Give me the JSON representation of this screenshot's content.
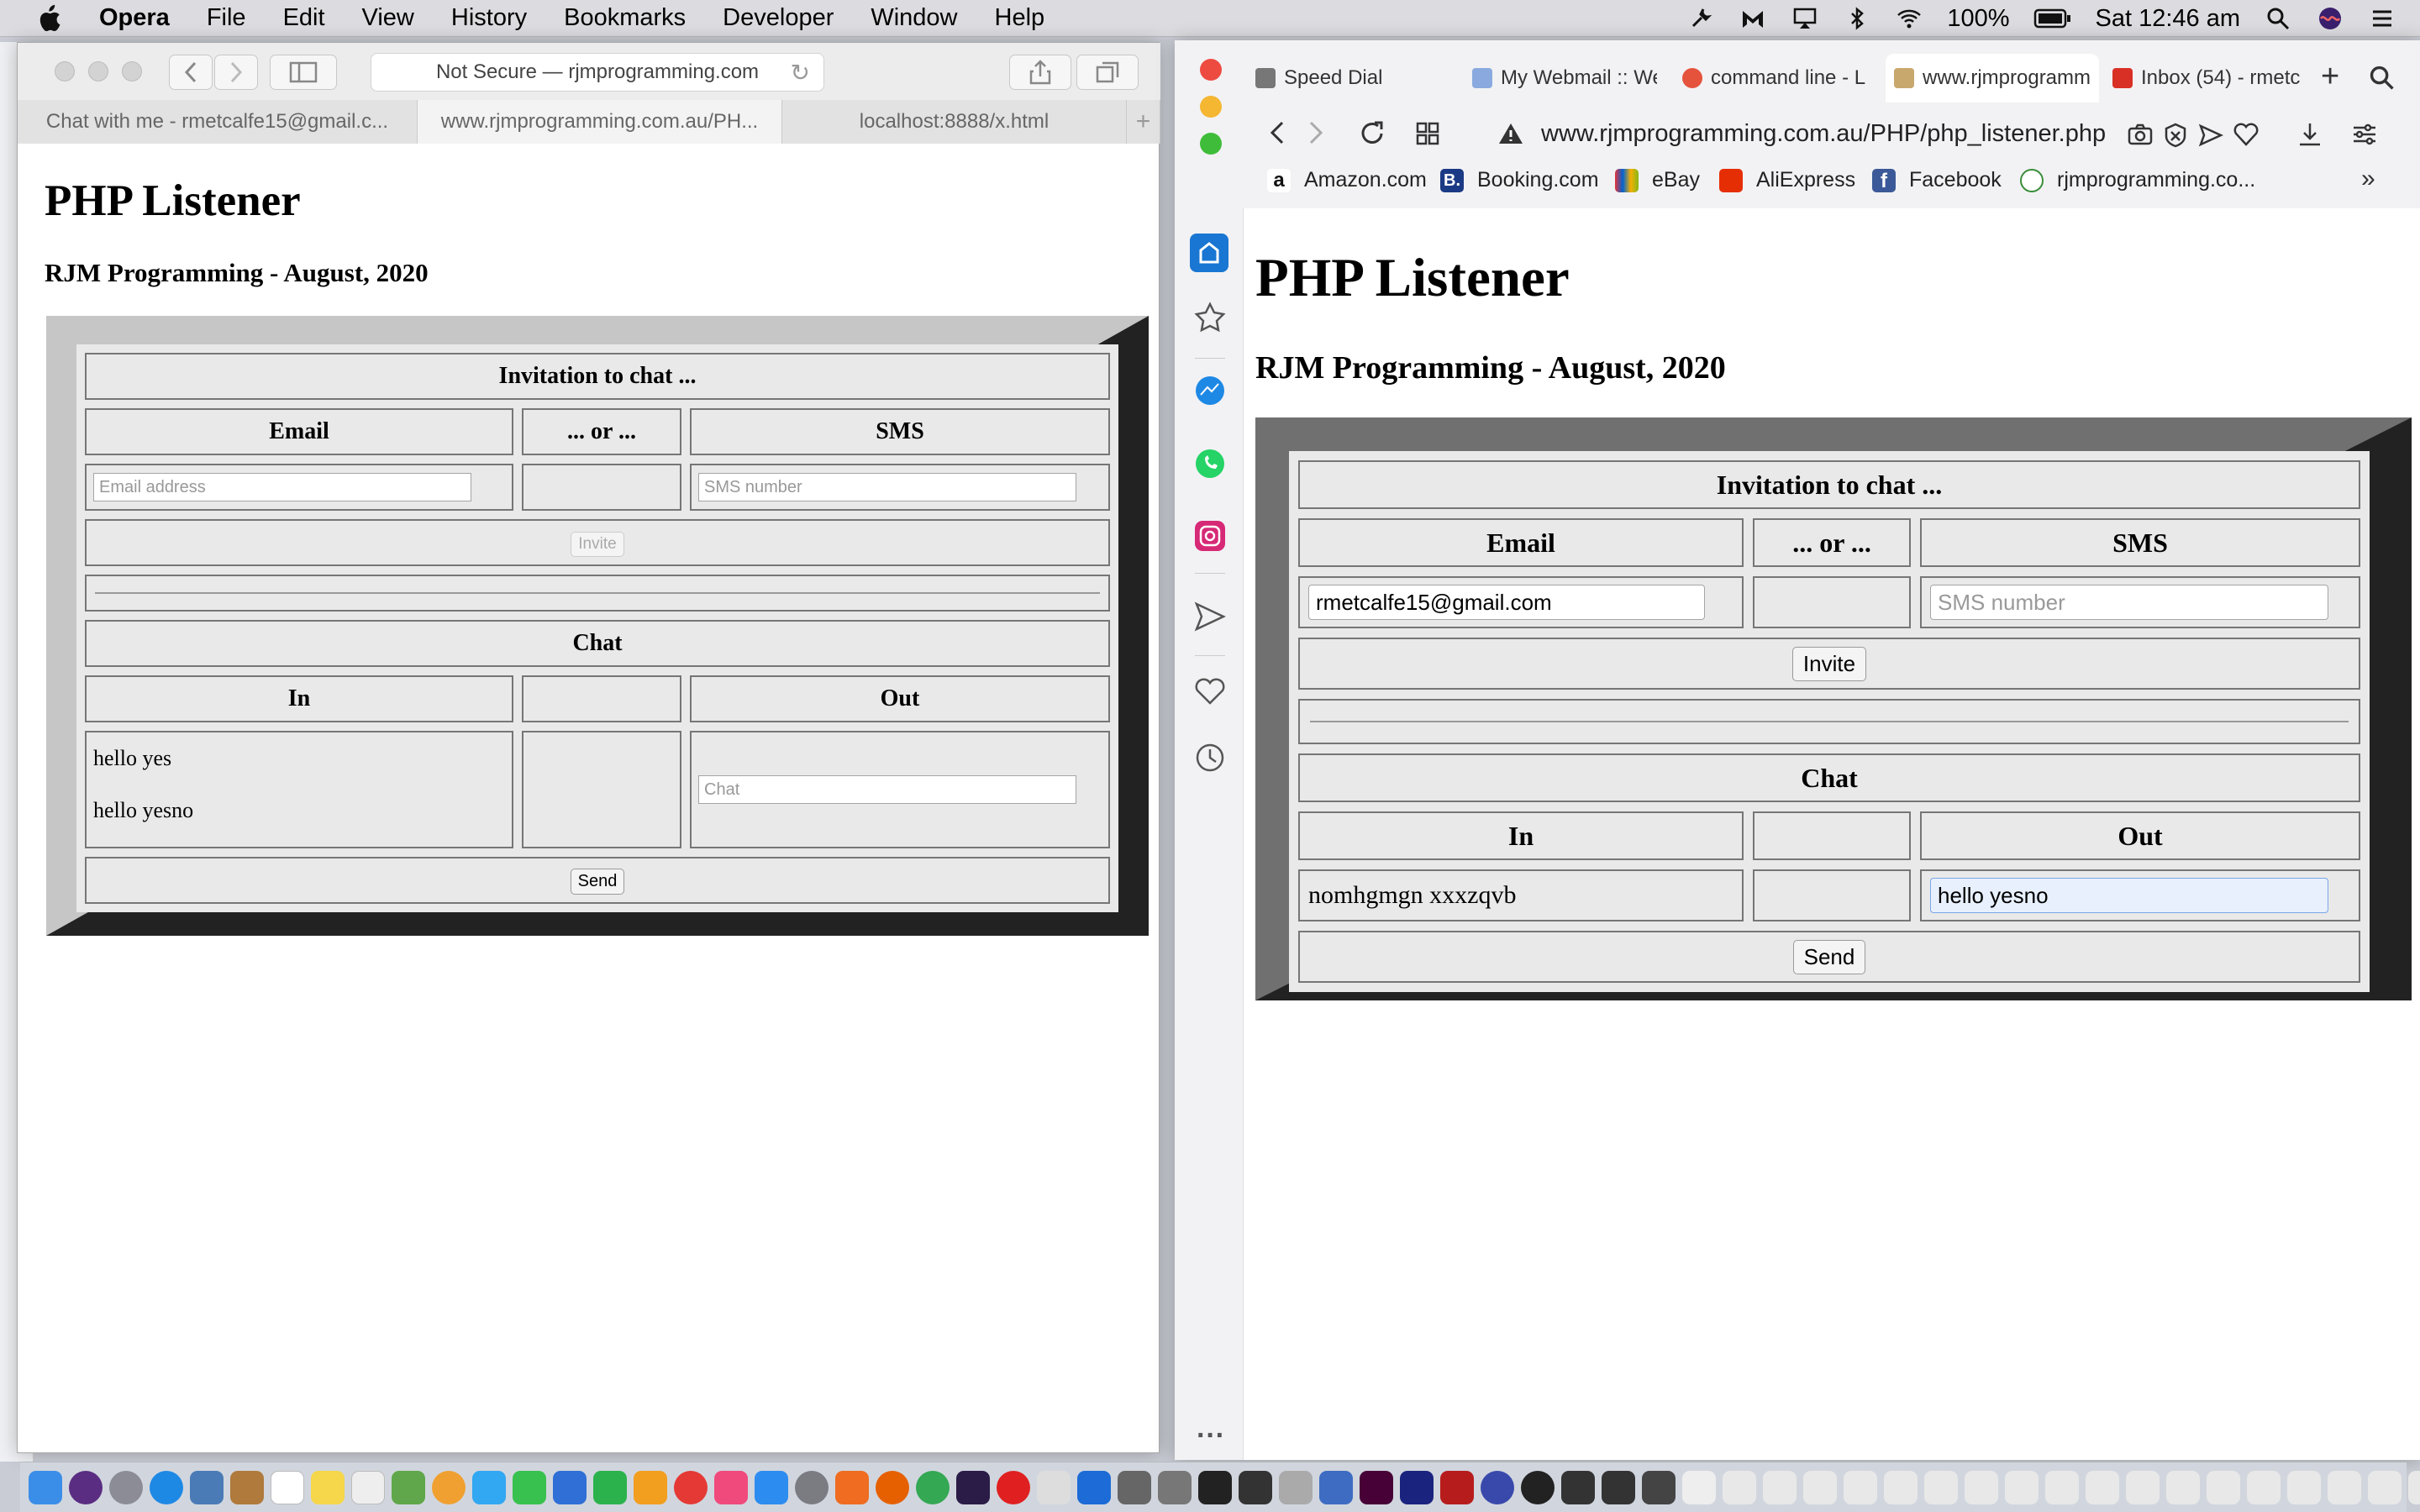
{
  "menubar": {
    "app_name": "Opera",
    "items": [
      "File",
      "Edit",
      "View",
      "History",
      "Bookmarks",
      "Developer",
      "Window",
      "Help"
    ],
    "battery": "100%",
    "clock": "Sat 12:46 am"
  },
  "left_window": {
    "address": "Not Secure — rjmprogramming.com",
    "tabs": [
      "Chat with me - rmetcalfe15@gmail.c...",
      "www.rjmprogramming.com.au/PH...",
      "localhost:8888/x.html"
    ],
    "page": {
      "title": "PHP Listener",
      "subtitle": "RJM Programming - August, 2020",
      "invite_heading": "Invitation to chat ...",
      "col_email": "Email",
      "col_or": "... or ...",
      "col_sms": "SMS",
      "email_value": "",
      "email_placeholder": "Email address",
      "sms_value": "",
      "sms_placeholder": "SMS number",
      "invite_button": "Invite",
      "chat_heading": "Chat",
      "col_in": "In",
      "col_out": "Out",
      "in_messages": [
        "hello yes",
        "hello yesno"
      ],
      "chat_value": "",
      "chat_placeholder": "Chat",
      "send_button": "Send"
    }
  },
  "right_window": {
    "tabs": [
      "Speed Dial",
      "My Webmail :: We",
      "command line - L",
      "www.rjmprogramm",
      "Inbox (54) - rmetc"
    ],
    "address": "www.rjmprogramming.com.au/PHP/php_listener.php",
    "bookmarks": [
      "Amazon.com",
      "Booking.com",
      "eBay",
      "AliExpress",
      "Facebook",
      "rjmprogramming.co..."
    ],
    "page": {
      "title": "PHP Listener",
      "subtitle": "RJM Programming - August, 2020",
      "invite_heading": "Invitation to chat ...",
      "col_email": "Email",
      "col_or": "... or ...",
      "col_sms": "SMS",
      "email_value": "rmetcalfe15@gmail.com",
      "sms_placeholder": "SMS number",
      "invite_button": "Invite",
      "chat_heading": "Chat",
      "col_in": "In",
      "col_out": "Out",
      "in_message": "nomhgmgn xxxzqvb",
      "chat_value": "hello yesno",
      "send_button": "Send"
    }
  },
  "colors": {
    "frame_dark": "#222222",
    "frame_light_left": "#c6c6c6",
    "frame_light_right": "#707070",
    "cell_bg": "#e9e9e9"
  }
}
